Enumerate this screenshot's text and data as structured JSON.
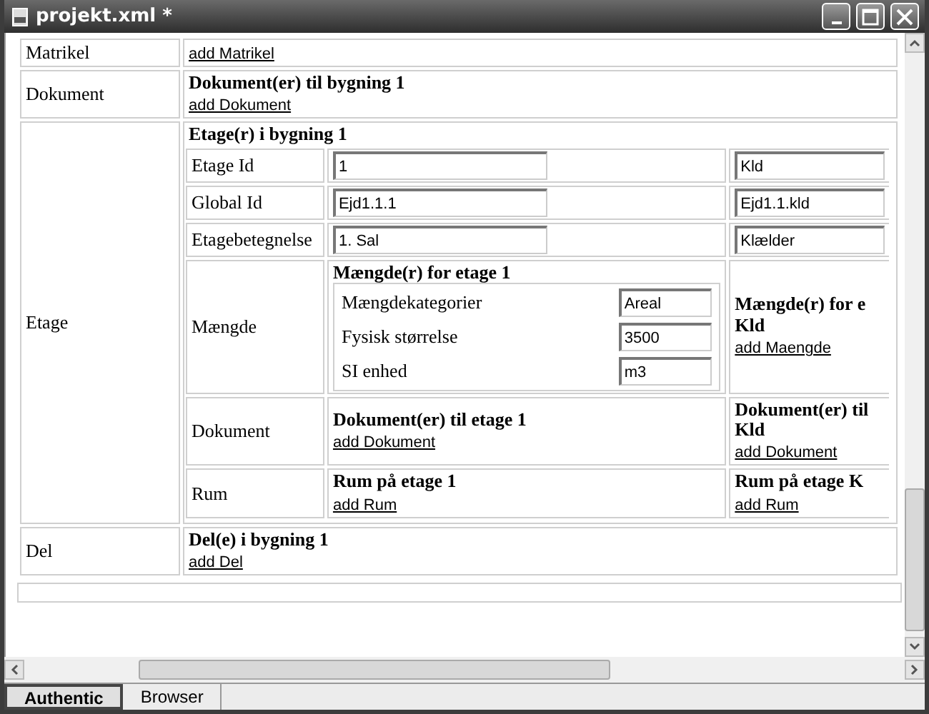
{
  "window": {
    "title": "projekt.xml *"
  },
  "rows": [
    {
      "label": "Matrikel",
      "cell": {
        "link": "add Matrikel"
      }
    },
    {
      "label": "Dokument",
      "cell": {
        "heading": "Dokument(er) til bygning 1",
        "link": "add Dokument"
      }
    },
    {
      "label": "Etage",
      "cell": {
        "heading": "Etage(r) i bygning 1",
        "subrows": [
          {
            "label": "Etage Id",
            "cells": [
              {
                "value": "1"
              },
              {
                "value": "Kld"
              }
            ]
          },
          {
            "label": "Global Id",
            "cells": [
              {
                "value": "Ejd1.1.1"
              },
              {
                "value": "Ejd1.1.kld"
              }
            ]
          },
          {
            "label": "Etagebetegnelse",
            "cells": [
              {
                "value": "1. Sal"
              },
              {
                "value": "Klælder"
              }
            ]
          },
          {
            "label": "Mængde",
            "cells": [
              {
                "heading": "Mængde(r) for etage 1",
                "fields": [
                  {
                    "label": "Mængdekategorier",
                    "value": "Areal"
                  },
                  {
                    "label": "Fysisk størrelse",
                    "value": "3500"
                  },
                  {
                    "label": "SI enhed",
                    "value": "m3"
                  }
                ]
              },
              {
                "heading": "Mængde(r) for e\nKld",
                "link": "add Maengde"
              }
            ]
          },
          {
            "label": "Dokument",
            "cells": [
              {
                "heading": "Dokument(er) til etage 1",
                "link": "add Dokument"
              },
              {
                "heading": "Dokument(er) til\nKld",
                "link": "add Dokument"
              }
            ]
          },
          {
            "label": "Rum",
            "cells": [
              {
                "heading": "Rum på etage 1",
                "link": "add Rum"
              },
              {
                "heading": "Rum på etage K",
                "link": "add Rum"
              }
            ]
          }
        ]
      }
    },
    {
      "label": "Del",
      "cell": {
        "heading": "Del(e) i bygning 1",
        "link": "add Del"
      }
    }
  ],
  "tabs": [
    {
      "label": "Authentic",
      "selected": true
    },
    {
      "label": "Browser",
      "selected": false
    }
  ]
}
